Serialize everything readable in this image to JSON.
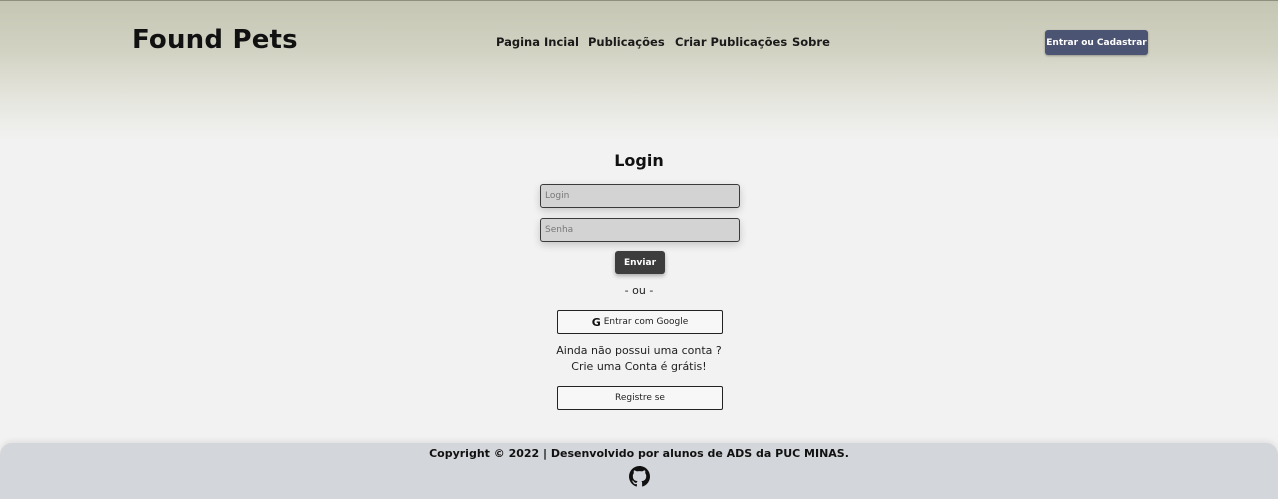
{
  "brand": "Found Pets",
  "nav": [
    "Pagina Incial",
    "Publicações",
    "Criar Publicações",
    "Sobre"
  ],
  "header_button": "Entrar ou Cadastrar",
  "login": {
    "title": "Login",
    "login_placeholder": "Login",
    "password_placeholder": "Senha",
    "submit": "Enviar",
    "separator": "- ou -",
    "google_icon": "G",
    "google_button": "Entrar com Google",
    "no_account_line1": "Ainda não possui uma conta ?",
    "no_account_line2": "Crie uma Conta é grátis!",
    "register_button": "Registre se"
  },
  "footer": {
    "copyright": "Copyright © 2022 | Desenvolvido por alunos de ADS da PUC MINAS.",
    "icon": "github-icon"
  },
  "colors": {
    "header_button_bg": "#4b5472",
    "submit_bg": "#3d3d3d",
    "footer_bg": "#d3d6da"
  }
}
